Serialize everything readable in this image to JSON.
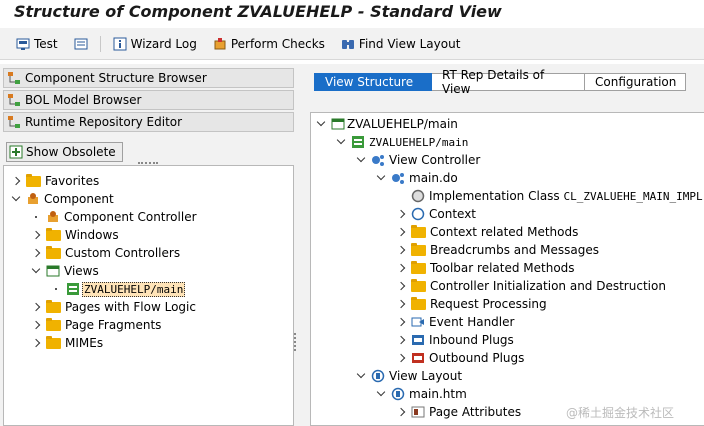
{
  "window": {
    "title": "Structure of Component ZVALUEHELP - Standard View"
  },
  "toolbar": {
    "test": "Test",
    "wizard_log": "Wizard Log",
    "perform_checks": "Perform Checks",
    "find_view_layout": "Find View Layout"
  },
  "left": {
    "nav": [
      {
        "label": "Component Structure Browser"
      },
      {
        "label": "BOL Model Browser"
      },
      {
        "label": "Runtime Repository Editor"
      }
    ],
    "show_obsolete": "Show Obsolete",
    "tree": {
      "favorites": "Favorites",
      "component": "Component",
      "component_controller": "Component Controller",
      "windows": "Windows",
      "custom_controllers": "Custom Controllers",
      "views": "Views",
      "view_item": "ZVALUEHELP/main",
      "pages_flow": "Pages with Flow Logic",
      "page_fragments": "Page Fragments",
      "mimes": "MIMEs"
    }
  },
  "right": {
    "tabs": [
      "View Structure",
      "RT Rep Details of View",
      "Configuration"
    ],
    "tree": {
      "root": "ZVALUEHELP/main",
      "comp": "ZVALUEHELP/main",
      "view_controller": "View Controller",
      "main_do": "main.do",
      "impl_class_label": "Implementation Class",
      "impl_class_value": "CL_ZVALUEHE_MAIN_IMPL",
      "context": "Context",
      "context_methods": "Context related Methods",
      "breadcrumbs": "Breadcrumbs and Messages",
      "toolbar_methods": "Toolbar related Methods",
      "controller_init": "Controller Initialization and Destruction",
      "request_processing": "Request Processing",
      "event_handler": "Event Handler",
      "inbound_plugs": "Inbound Plugs",
      "outbound_plugs": "Outbound Plugs",
      "view_layout": "View Layout",
      "main_htm": "main.htm",
      "page_attributes": "Page Attributes"
    }
  },
  "watermark": "@稀土掘金技术社区",
  "colors": {
    "tab_active": "#1a6ec8",
    "folder": "#f0b200",
    "selection": "#ffe4b8"
  }
}
